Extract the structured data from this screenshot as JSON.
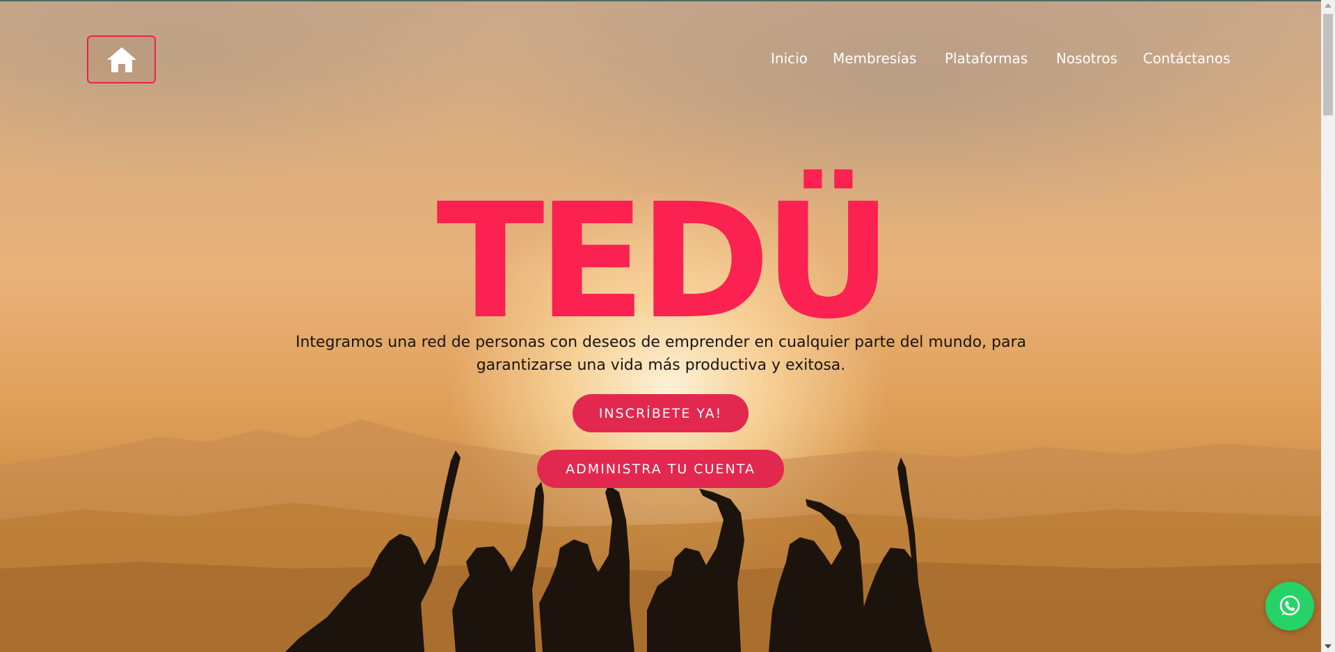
{
  "brand": {
    "logo_text": "TEDÜ"
  },
  "nav": {
    "home_icon": "home-icon",
    "items": [
      {
        "label": "Inicio"
      },
      {
        "label": "Membresías"
      },
      {
        "label": "Plataformas"
      },
      {
        "label": "Nosotros"
      },
      {
        "label": "Contáctanos"
      }
    ]
  },
  "hero": {
    "tagline_line1": "Integramos una red de personas con deseos de emprender en cualquier parte del mundo, para",
    "tagline_line2": "garantizarse una vida más productiva y exitosa.",
    "signup_label": "INSCRÍBETE YA!",
    "account_label": "ADMINISTRA TU CUENTA"
  },
  "floating": {
    "whatsapp_icon": "whatsapp-icon"
  },
  "colors": {
    "accent": "#fb2150",
    "button": "#e2284f",
    "whatsapp": "#25d366",
    "nav_text": "#ffffff"
  }
}
